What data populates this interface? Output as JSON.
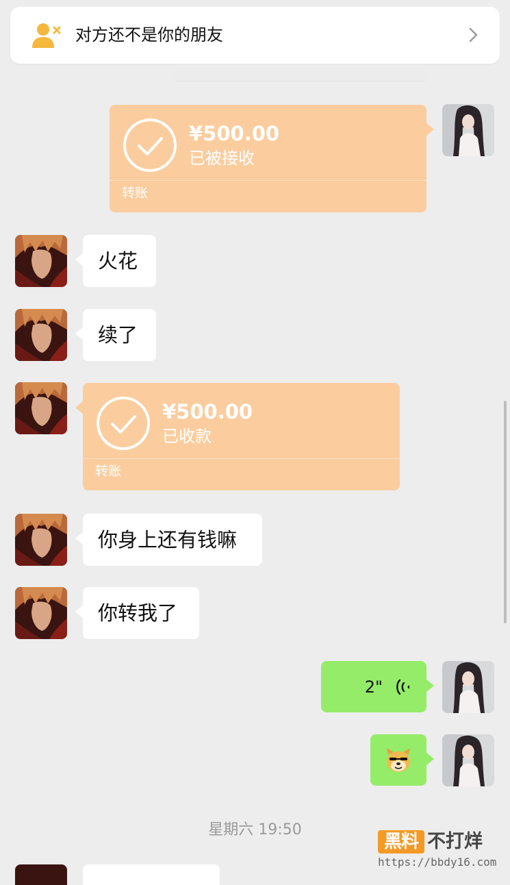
{
  "banner": {
    "text": "对方还不是你的朋友",
    "icon": "person-x-icon",
    "chevron": "chevron-right-icon",
    "icon_color": "#f5b83d"
  },
  "colors": {
    "background": "#ededed",
    "transfer_bg": "#fbcd9e",
    "sent_bubble": "#95ec69",
    "received_bubble": "#ffffff"
  },
  "messages": {
    "m1": {
      "direction": "sent",
      "type": "transfer",
      "amount": "¥500.00",
      "status": "已被接收",
      "label": "转账"
    },
    "m2": {
      "direction": "received",
      "type": "text",
      "text": "火花"
    },
    "m3": {
      "direction": "received",
      "type": "text",
      "text": "续了"
    },
    "m4": {
      "direction": "received",
      "type": "transfer",
      "amount": "¥500.00",
      "status": "已收款",
      "label": "转账"
    },
    "m5": {
      "direction": "received",
      "type": "text",
      "text": "你身上还有钱嘛"
    },
    "m6": {
      "direction": "received",
      "type": "text",
      "text": "你转我了"
    },
    "m7": {
      "direction": "sent",
      "type": "voice",
      "duration": "2\""
    },
    "m8": {
      "direction": "sent",
      "type": "sticker",
      "sticker": "doge-sticker"
    }
  },
  "timestamp": "星期六 19:50",
  "watermark": {
    "badge": "黑料",
    "brand": "不打烊",
    "url": "https://bbdy16.com"
  }
}
